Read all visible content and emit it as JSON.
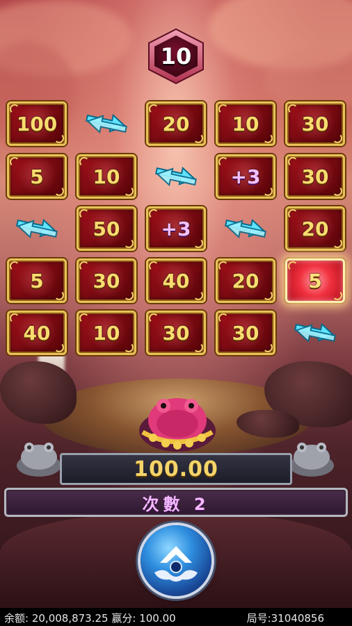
{
  "round_counter": "10",
  "grid": {
    "rows": [
      [
        {
          "type": "value",
          "label": "100"
        },
        {
          "type": "arrow"
        },
        {
          "type": "value",
          "label": "20"
        },
        {
          "type": "value",
          "label": "10"
        },
        {
          "type": "value",
          "label": "30"
        }
      ],
      [
        {
          "type": "value",
          "label": "5"
        },
        {
          "type": "value",
          "label": "10"
        },
        {
          "type": "arrow"
        },
        {
          "type": "plus",
          "label": "+3"
        },
        {
          "type": "value",
          "label": "30"
        }
      ],
      [
        {
          "type": "arrow"
        },
        {
          "type": "value",
          "label": "50"
        },
        {
          "type": "plus",
          "label": "+3"
        },
        {
          "type": "arrow"
        },
        {
          "type": "value",
          "label": "20"
        }
      ],
      [
        {
          "type": "value",
          "label": "5"
        },
        {
          "type": "value",
          "label": "30"
        },
        {
          "type": "value",
          "label": "40"
        },
        {
          "type": "value",
          "label": "20"
        },
        {
          "type": "active",
          "label": "5"
        }
      ],
      [
        {
          "type": "value",
          "label": "40"
        },
        {
          "type": "value",
          "label": "10"
        },
        {
          "type": "value",
          "label": "30"
        },
        {
          "type": "value",
          "label": "30"
        },
        {
          "type": "arrow"
        }
      ]
    ]
  },
  "win_amount": "100.00",
  "count_label": "次數 2",
  "footer": {
    "balance_label": "余额:",
    "balance_value": "20,008,873.25",
    "win_label": "赢分:",
    "win_value": "100.00",
    "round_label": "局号:",
    "round_value": "31040856"
  },
  "colors": {
    "tile_red": "#8a0d15",
    "tile_gold": "#e9c25a",
    "arrow_cyan": "#5fe4ff",
    "win_gold": "#f5d56a",
    "count_pink": "#f4b8ff"
  },
  "icons": [
    "swap-arrows-icon",
    "toad-icon",
    "stone-toad-icon",
    "spin-arrow-icon"
  ]
}
